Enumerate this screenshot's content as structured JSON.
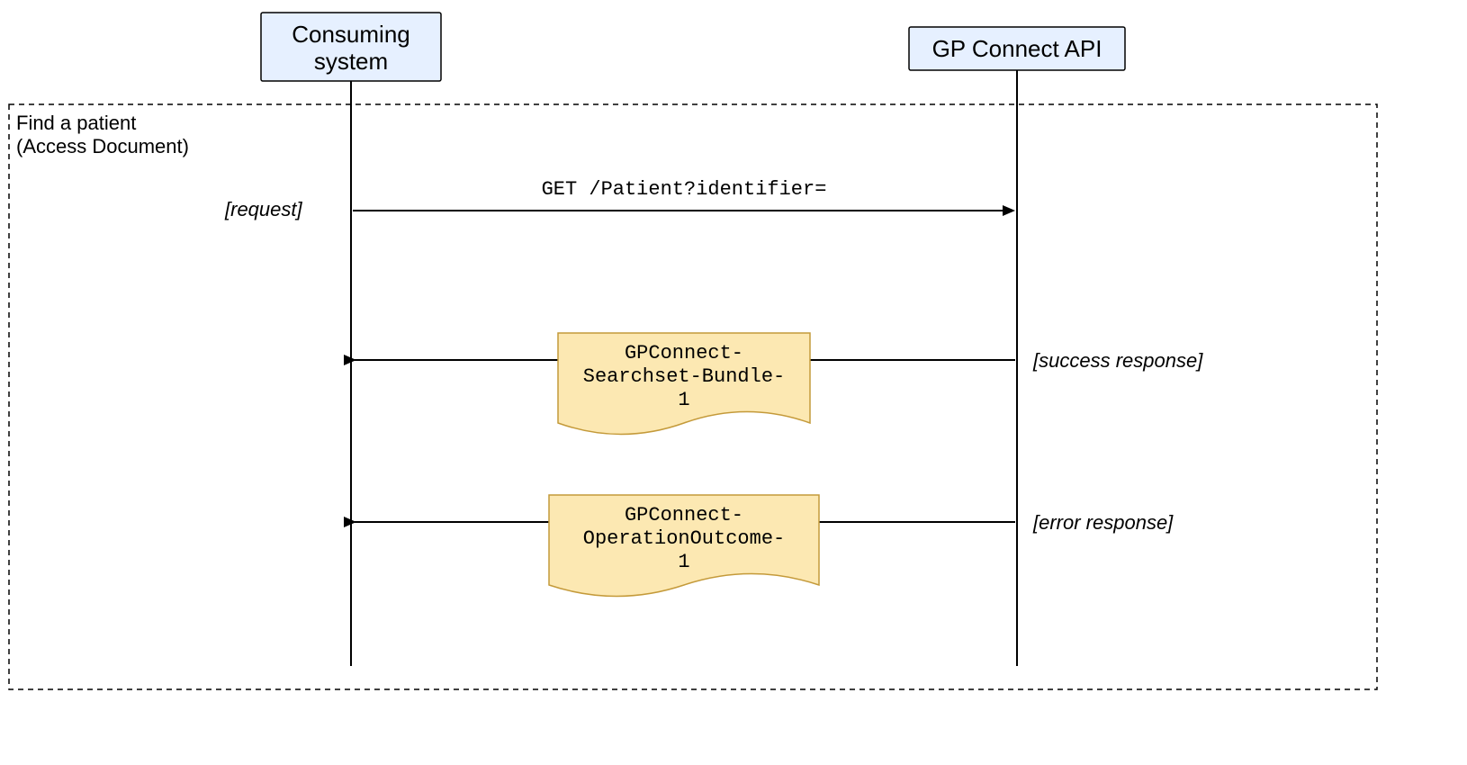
{
  "participants": {
    "left": {
      "name": "Consuming system"
    },
    "right": {
      "name": "GP Connect API"
    }
  },
  "frame": {
    "title_line1": "Find a patient",
    "title_line2": "(Access Document)"
  },
  "messages": {
    "request": {
      "guard": "[request]",
      "label": "GET /Patient?identifier="
    },
    "success": {
      "guard": "[success response]",
      "note_line1": "GPConnect-",
      "note_line2": "Searchset-Bundle-",
      "note_line3": "1"
    },
    "error": {
      "guard": "[error response]",
      "note_line1": "GPConnect-",
      "note_line2": "OperationOutcome-",
      "note_line3": "1"
    }
  }
}
